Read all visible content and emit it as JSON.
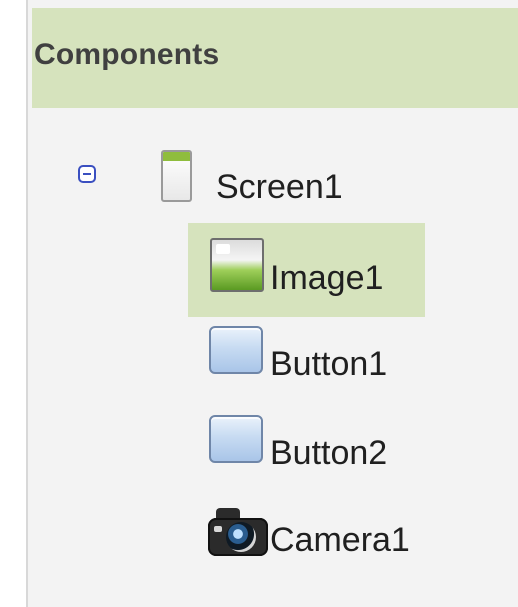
{
  "panel": {
    "title": "Components"
  },
  "tree": {
    "root": {
      "label": "Screen1",
      "expanded": true,
      "toggle_icon": "minus-box-icon",
      "icon": "screen-icon"
    },
    "children": [
      {
        "label": "Image1",
        "icon": "image-icon",
        "selected": true
      },
      {
        "label": "Button1",
        "icon": "button-icon",
        "selected": false
      },
      {
        "label": "Button2",
        "icon": "button-icon",
        "selected": false
      },
      {
        "label": "Camera1",
        "icon": "camera-icon",
        "selected": false
      }
    ]
  },
  "colors": {
    "header_bg": "#d6e3bd",
    "selected_bg": "#d6e3bd",
    "panel_bg": "#f3f3f3",
    "toggle_color": "#3a4fc0"
  }
}
